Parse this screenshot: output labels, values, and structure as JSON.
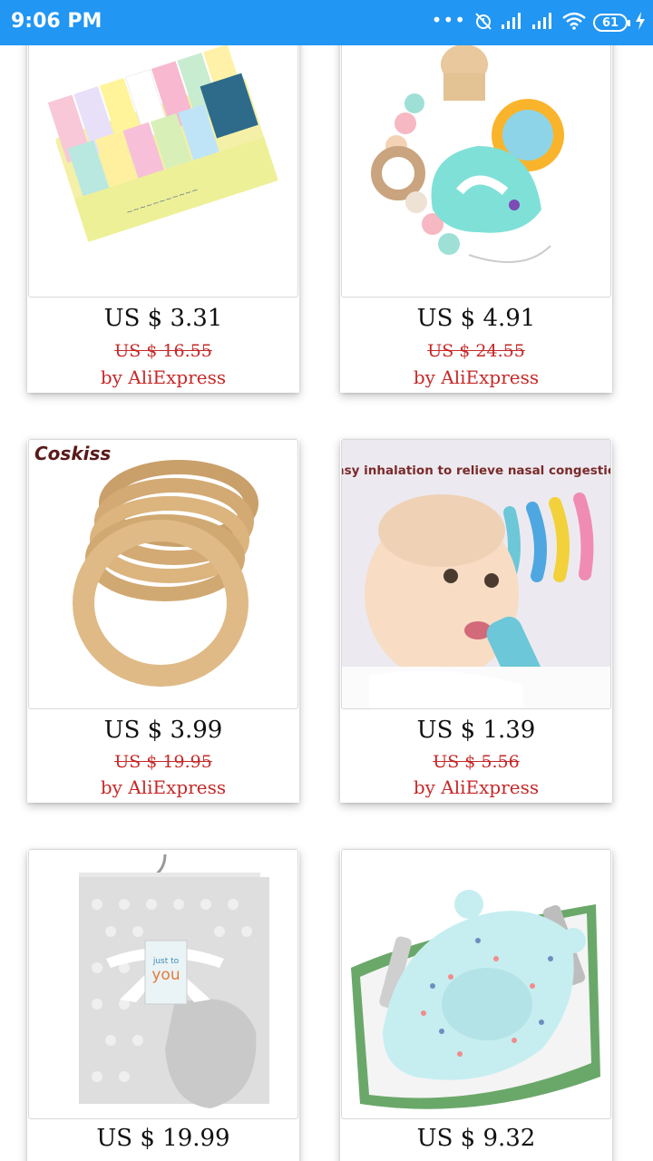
{
  "status_bar": {
    "time": "9:06 PM",
    "dots": "•••",
    "battery": "61"
  },
  "products": [
    {
      "price": "US $ 3.31",
      "old_price": "US $ 16.55",
      "seller": "by AliExpress",
      "image": "baby-washcloths"
    },
    {
      "price": "US $ 4.91",
      "old_price": "US $ 24.55",
      "seller": "by AliExpress",
      "image": "lion-teether-pacifier-clip"
    },
    {
      "price": "US $ 3.99",
      "old_price": "US $ 19.95",
      "seller": "by AliExpress",
      "image": "wooden-teething-rings",
      "brand": "Coskiss"
    },
    {
      "price": "US $ 1.39",
      "old_price": "US $ 5.56",
      "seller": "by AliExpress",
      "image": "nasal-aspirator",
      "caption": "Easy inhalation to relieve nasal congestion"
    },
    {
      "price": "US $ 19.99",
      "image": "baby-blanket",
      "tag_line1": "just to",
      "tag_line2": "you"
    },
    {
      "price": "US $ 9.32",
      "image": "baby-bath-cushion"
    }
  ]
}
